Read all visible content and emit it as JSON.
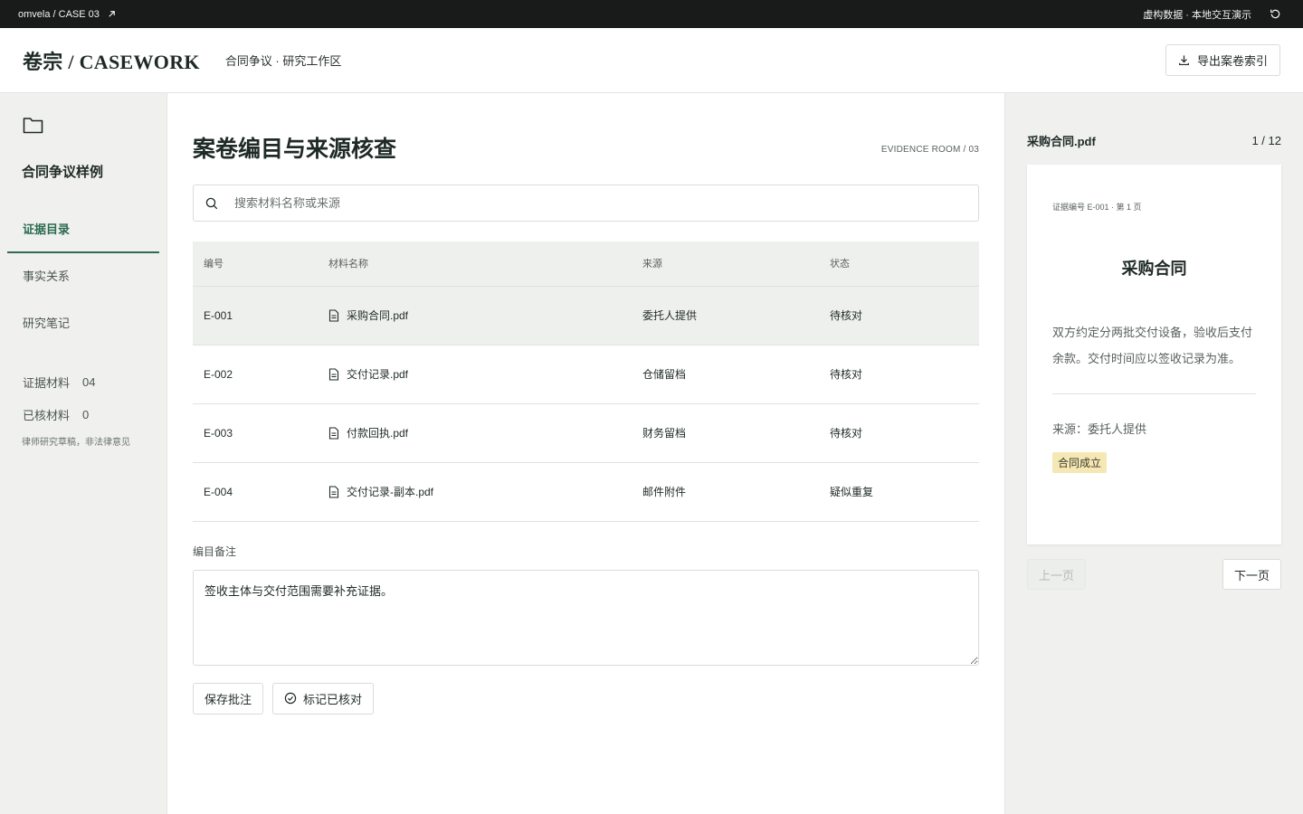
{
  "topbar": {
    "crumb": "omvela / CASE 03",
    "notice": "虚构数据 · 本地交互演示"
  },
  "header": {
    "brand": "卷宗 / CASEWORK",
    "subtitle": "合同争议 · 研究工作区",
    "export_label": "导出案卷索引"
  },
  "sidebar": {
    "case_name": "合同争议样例",
    "nav": [
      {
        "label": "证据目录",
        "active": true
      },
      {
        "label": "事实关系",
        "active": false
      },
      {
        "label": "研究笔记",
        "active": false
      }
    ],
    "stats": [
      {
        "label": "证据材料",
        "value": "04"
      },
      {
        "label": "已核材料",
        "value": "0"
      }
    ],
    "disclaimer": "律师研究草稿，非法律意见"
  },
  "main": {
    "title": "案卷编目与来源核查",
    "room_label": "EVIDENCE ROOM / 03",
    "search_placeholder": "搜索材料名称或来源",
    "table": {
      "headers": [
        "编号",
        "材料名称",
        "来源",
        "状态"
      ],
      "rows": [
        {
          "id": "E-001",
          "name": "采购合同.pdf",
          "source": "委托人提供",
          "status": "待核对",
          "selected": true
        },
        {
          "id": "E-002",
          "name": "交付记录.pdf",
          "source": "仓储留档",
          "status": "待核对",
          "selected": false
        },
        {
          "id": "E-003",
          "name": "付款回执.pdf",
          "source": "财务留档",
          "status": "待核对",
          "selected": false
        },
        {
          "id": "E-004",
          "name": "交付记录-副本.pdf",
          "source": "邮件附件",
          "status": "疑似重复",
          "selected": false
        }
      ]
    },
    "notes_label": "编目备注",
    "notes_value": "签收主体与交付范围需要补充证据。",
    "save_label": "保存批注",
    "mark_label": "标记已核对"
  },
  "preview": {
    "file_name": "采购合同.pdf",
    "page_indicator": "1 / 12",
    "doc_meta": "证据编号 E-001 · 第 1 页",
    "doc_title": "采购合同",
    "doc_body": "双方约定分两批交付设备，验收后支付余款。交付时间应以签收记录为准。",
    "doc_source": "来源：委托人提供",
    "doc_tag": "合同成立",
    "prev_label": "上一页",
    "next_label": "下一页"
  },
  "colors": {
    "accent": "#2f6b50",
    "topbar": "#181b1a",
    "tag_bg": "#f6e8b4"
  }
}
